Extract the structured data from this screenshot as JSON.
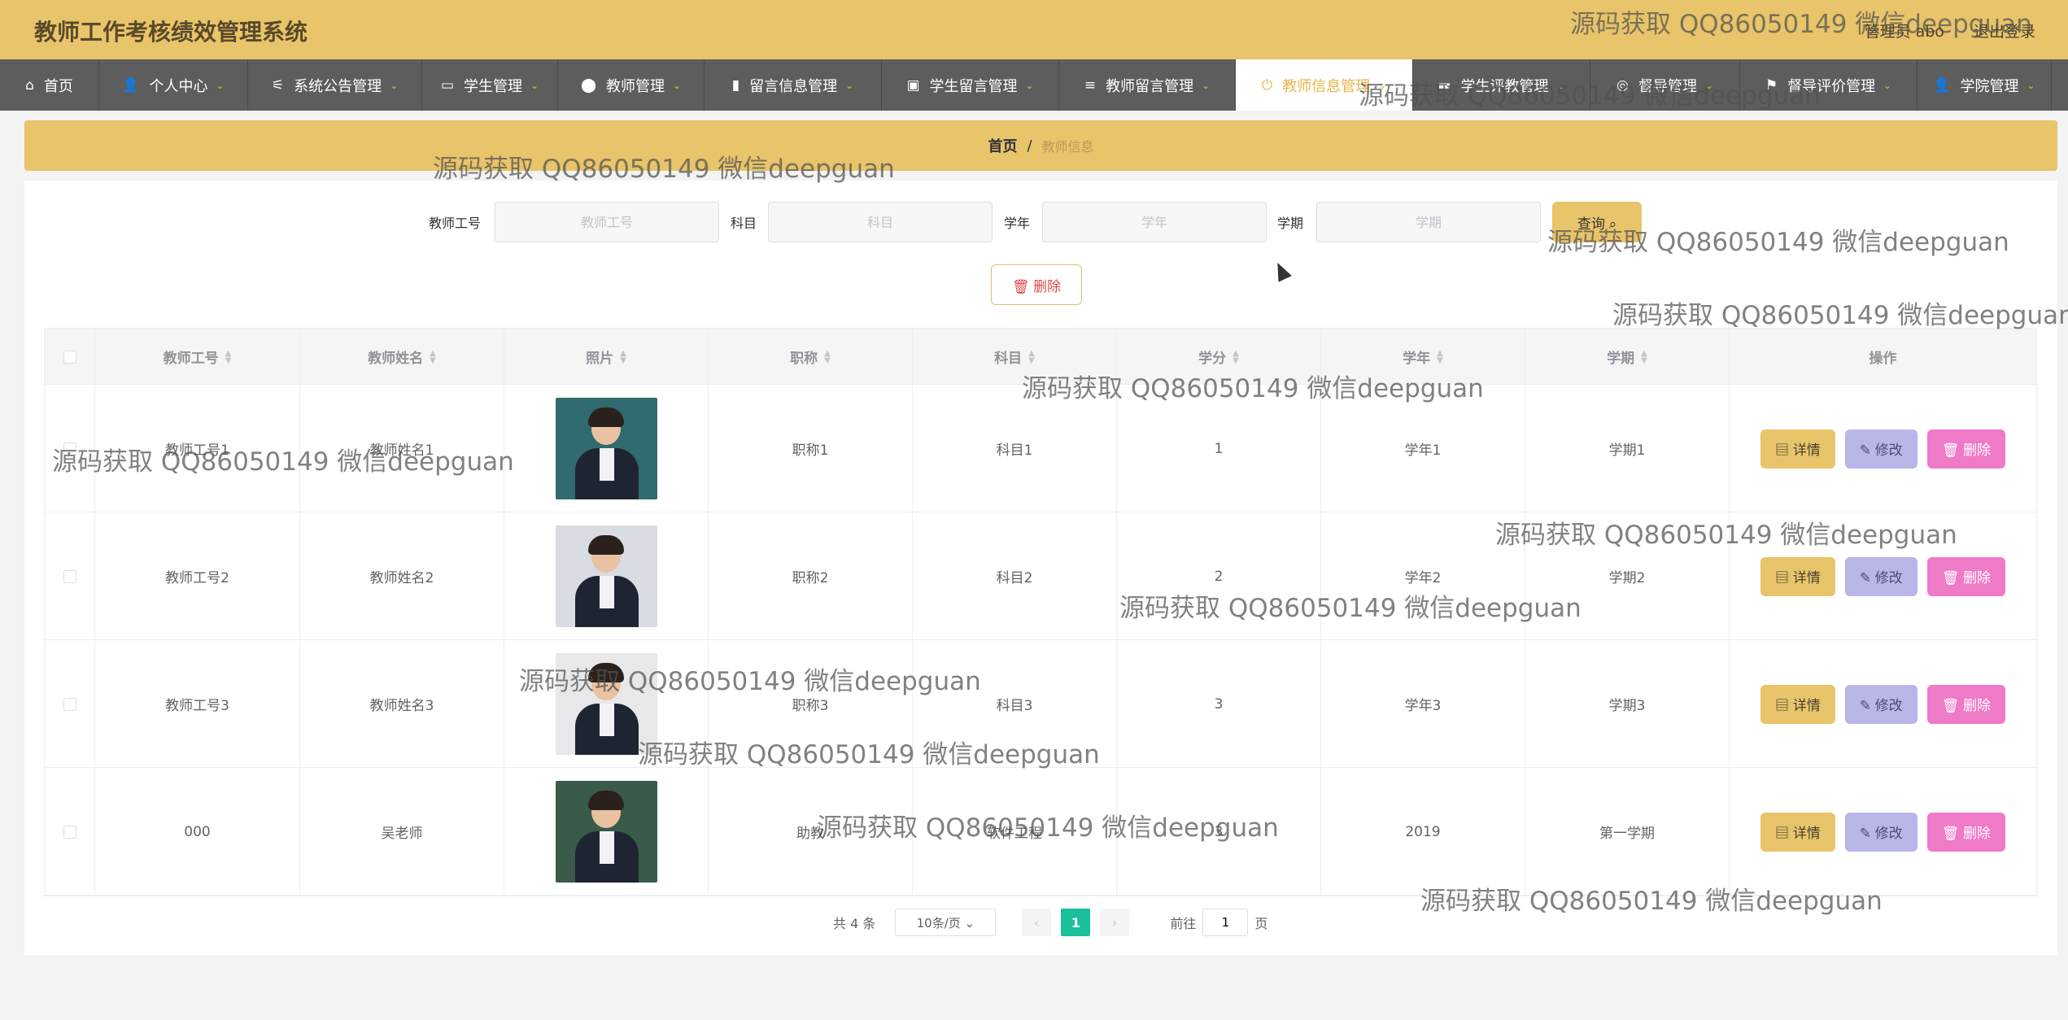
{
  "header": {
    "title": "教师工作考核绩效管理系统",
    "role": "管理员 abo",
    "logout": "退出登录"
  },
  "nav": [
    {
      "label": "首页",
      "icon": "⌂"
    },
    {
      "label": "个人中心",
      "icon": "👤"
    },
    {
      "label": "系统公告管理",
      "icon": "⚟"
    },
    {
      "label": "学生管理",
      "icon": "▭"
    },
    {
      "label": "教师管理",
      "icon": "⬤"
    },
    {
      "label": "留言信息管理",
      "icon": "▮"
    },
    {
      "label": "学生留言管理",
      "icon": "▣"
    },
    {
      "label": "教师留言管理",
      "icon": "≡"
    },
    {
      "label": "教师信息管理",
      "icon": "⏻"
    },
    {
      "label": "学生评教管理",
      "icon": "▬"
    },
    {
      "label": "督导管理",
      "icon": "◎"
    },
    {
      "label": "督导评价管理",
      "icon": "⚑"
    },
    {
      "label": "学院管理",
      "icon": "👤"
    }
  ],
  "breadcrumb": {
    "home": "首页",
    "sep": "/",
    "current": "教师信息"
  },
  "search": {
    "fields": [
      {
        "label": "教师工号",
        "placeholder": "教师工号"
      },
      {
        "label": "科目",
        "placeholder": "科目"
      },
      {
        "label": "学年",
        "placeholder": "学年"
      },
      {
        "label": "学期",
        "placeholder": "学期"
      }
    ],
    "query_label": "查询 ⌕",
    "delete_label": "🗑 删除"
  },
  "table": {
    "columns": [
      "教师工号",
      "教师姓名",
      "照片",
      "职称",
      "科目",
      "学分",
      "学年",
      "学期",
      "操作"
    ],
    "rows": [
      {
        "id": "教师工号1",
        "name": "教师姓名1",
        "title": "职称1",
        "subject": "科目1",
        "credit": "1",
        "year": "学年1",
        "term": "学期1",
        "photo_color": "#2f6b6f"
      },
      {
        "id": "教师工号2",
        "name": "教师姓名2",
        "title": "职称2",
        "subject": "科目2",
        "credit": "2",
        "year": "学年2",
        "term": "学期2",
        "photo_color": "#d9dce2"
      },
      {
        "id": "教师工号3",
        "name": "教师姓名3",
        "title": "职称3",
        "subject": "科目3",
        "credit": "3",
        "year": "学年3",
        "term": "学期3",
        "photo_color": "#e8e8ea"
      },
      {
        "id": "000",
        "name": "吴老师",
        "title": "助教",
        "subject": "软件工程",
        "credit": "3",
        "year": "2019",
        "term": "第一学期",
        "photo_color": "#3a5a4a"
      }
    ],
    "actions": {
      "detail": "▤ 详情",
      "edit": "✎ 修改",
      "delete": "🗑 删除"
    }
  },
  "pager": {
    "total": "共 4 条",
    "size": "10条/页 ⌄",
    "prev": "‹",
    "page": "1",
    "next": "›",
    "goto": "前往",
    "goto_value": "1",
    "unit": "页"
  },
  "watermark": "源码获取 QQ86050149 微信deepguan",
  "colors": {
    "header": "#e8c46a",
    "nav": "#5d5d5d",
    "pager_active": "#19c09a",
    "delete": "#ef7ac8",
    "edit": "#b9b6e8"
  }
}
